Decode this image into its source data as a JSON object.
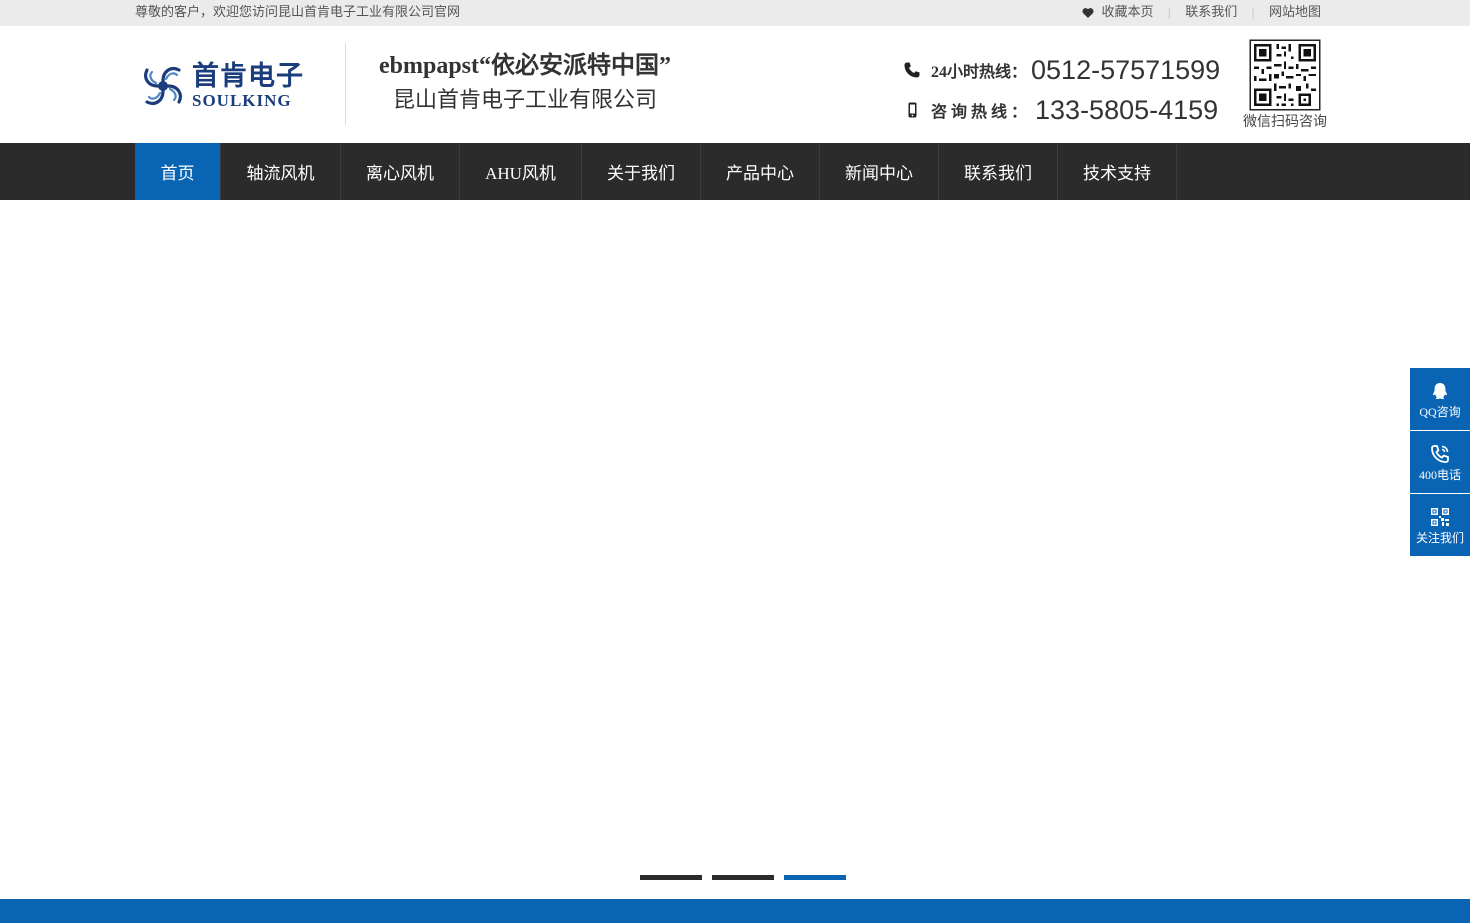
{
  "topbar": {
    "welcome": "尊敬的客户，欢迎您访问昆山首肯电子工业有限公司官网",
    "links": {
      "favorite": "收藏本页",
      "contact": "联系我们",
      "sitemap": "网站地图"
    }
  },
  "header": {
    "logo": {
      "cn": "首肯电子",
      "en": "SOULKING"
    },
    "slogan_line1": "ebmpapst“依必安派特中国”",
    "slogan_line2": "昆山首肯电子工业有限公司",
    "hotline": {
      "label_24h": "24小时热线：",
      "number_24h": "0512-57571599",
      "label_consult": "咨询热线：",
      "number_consult": "133-5805-4159"
    },
    "qr_caption": "微信扫码咨询"
  },
  "nav": {
    "items": [
      {
        "label": "首页"
      },
      {
        "label": "轴流风机"
      },
      {
        "label": "离心风机"
      },
      {
        "label": "AHU风机"
      },
      {
        "label": "关于我们"
      },
      {
        "label": "产品中心"
      },
      {
        "label": "新闻中心"
      },
      {
        "label": "联系我们"
      },
      {
        "label": "技术支持"
      }
    ],
    "active_index": 0
  },
  "banner": {
    "slide_count": 3,
    "active_slide": 3
  },
  "sidebar": {
    "qq": "QQ咨询",
    "phone": "400电话",
    "follow": "关注我们"
  },
  "colors": {
    "accent": "#0a64b4",
    "nav_bg": "#2b2b2b",
    "topbar_bg": "#ebebeb",
    "brand": "#1b3d7c"
  },
  "icons": [
    "heart-icon",
    "phone-icon",
    "mobile-icon",
    "qr-code-icon",
    "qq-icon",
    "call-icon",
    "scan-icon"
  ]
}
